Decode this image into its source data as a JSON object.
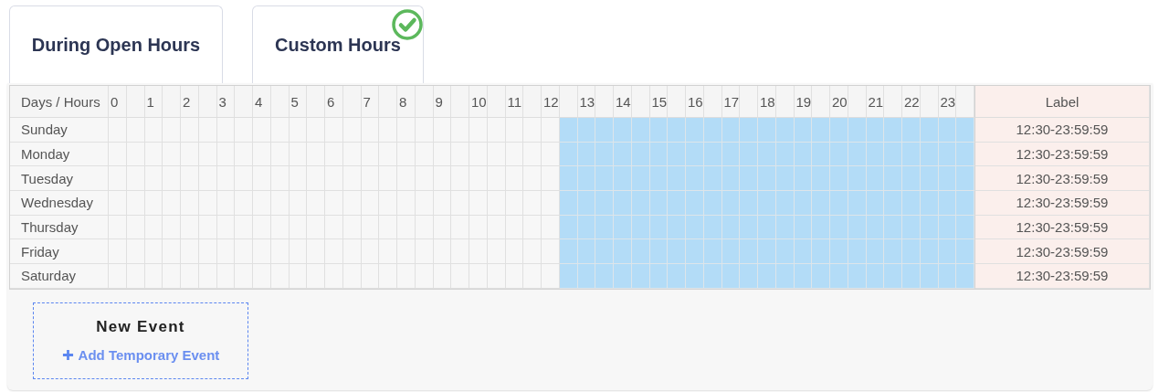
{
  "tabs": [
    {
      "label": "During Open Hours",
      "selected": false
    },
    {
      "label": "Custom Hours",
      "selected": true
    }
  ],
  "schedule": {
    "corner": "Days / Hours",
    "hours": [
      "0",
      "1",
      "2",
      "3",
      "4",
      "5",
      "6",
      "7",
      "8",
      "9",
      "10",
      "11",
      "12",
      "13",
      "14",
      "15",
      "16",
      "17",
      "18",
      "19",
      "20",
      "21",
      "22",
      "23"
    ],
    "label_heading": "Label",
    "rows": [
      {
        "day": "Sunday",
        "label": "12:30-23:59:59",
        "slots": [
          false,
          false,
          false,
          false,
          false,
          false,
          false,
          false,
          false,
          false,
          false,
          false,
          false,
          false,
          false,
          false,
          false,
          false,
          false,
          false,
          false,
          false,
          false,
          false,
          false,
          true,
          true,
          true,
          true,
          true,
          true,
          true,
          true,
          true,
          true,
          true,
          true,
          true,
          true,
          true,
          true,
          true,
          true,
          true,
          true,
          true,
          true,
          true
        ]
      },
      {
        "day": "Monday",
        "label": "12:30-23:59:59",
        "slots": [
          false,
          false,
          false,
          false,
          false,
          false,
          false,
          false,
          false,
          false,
          false,
          false,
          false,
          false,
          false,
          false,
          false,
          false,
          false,
          false,
          false,
          false,
          false,
          false,
          false,
          true,
          true,
          true,
          true,
          true,
          true,
          true,
          true,
          true,
          true,
          true,
          true,
          true,
          true,
          true,
          true,
          true,
          true,
          true,
          true,
          true,
          true,
          true
        ]
      },
      {
        "day": "Tuesday",
        "label": "12:30-23:59:59",
        "slots": [
          false,
          false,
          false,
          false,
          false,
          false,
          false,
          false,
          false,
          false,
          false,
          false,
          false,
          false,
          false,
          false,
          false,
          false,
          false,
          false,
          false,
          false,
          false,
          false,
          false,
          true,
          true,
          true,
          true,
          true,
          true,
          true,
          true,
          true,
          true,
          true,
          true,
          true,
          true,
          true,
          true,
          true,
          true,
          true,
          true,
          true,
          true,
          true
        ]
      },
      {
        "day": "Wednesday",
        "label": "12:30-23:59:59",
        "slots": [
          false,
          false,
          false,
          false,
          false,
          false,
          false,
          false,
          false,
          false,
          false,
          false,
          false,
          false,
          false,
          false,
          false,
          false,
          false,
          false,
          false,
          false,
          false,
          false,
          false,
          true,
          true,
          true,
          true,
          true,
          true,
          true,
          true,
          true,
          true,
          true,
          true,
          true,
          true,
          true,
          true,
          true,
          true,
          true,
          true,
          true,
          true,
          true
        ]
      },
      {
        "day": "Thursday",
        "label": "12:30-23:59:59",
        "slots": [
          false,
          false,
          false,
          false,
          false,
          false,
          false,
          false,
          false,
          false,
          false,
          false,
          false,
          false,
          false,
          false,
          false,
          false,
          false,
          false,
          false,
          false,
          false,
          false,
          false,
          true,
          true,
          true,
          true,
          true,
          true,
          true,
          true,
          true,
          true,
          true,
          true,
          true,
          true,
          true,
          true,
          true,
          true,
          true,
          true,
          true,
          true,
          true
        ]
      },
      {
        "day": "Friday",
        "label": "12:30-23:59:59",
        "slots": [
          false,
          false,
          false,
          false,
          false,
          false,
          false,
          false,
          false,
          false,
          false,
          false,
          false,
          false,
          false,
          false,
          false,
          false,
          false,
          false,
          false,
          false,
          false,
          false,
          false,
          true,
          true,
          true,
          true,
          true,
          true,
          true,
          true,
          true,
          true,
          true,
          true,
          true,
          true,
          true,
          true,
          true,
          true,
          true,
          true,
          true,
          true,
          true
        ]
      },
      {
        "day": "Saturday",
        "label": "12:30-23:59:59",
        "slots": [
          false,
          false,
          false,
          false,
          false,
          false,
          false,
          false,
          false,
          false,
          false,
          false,
          false,
          false,
          false,
          false,
          false,
          false,
          false,
          false,
          false,
          false,
          false,
          false,
          false,
          true,
          true,
          true,
          true,
          true,
          true,
          true,
          true,
          true,
          true,
          true,
          true,
          true,
          true,
          true,
          true,
          true,
          true,
          true,
          true,
          true,
          true,
          true
        ]
      }
    ]
  },
  "new_event": {
    "title": "New Event",
    "link": "Add Temporary Event"
  }
}
